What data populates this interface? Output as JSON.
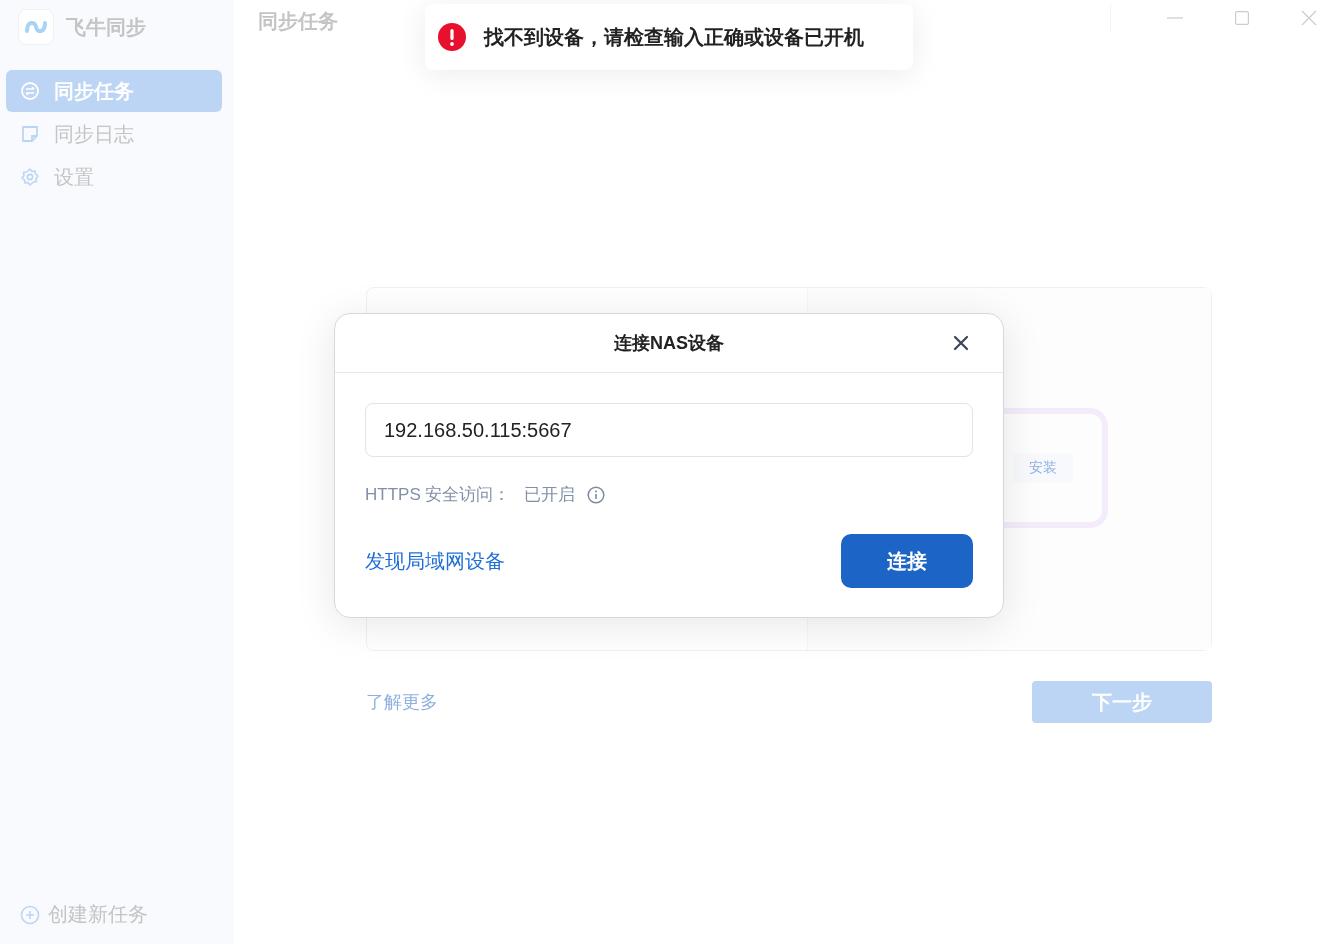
{
  "app": {
    "name": "飞牛同步"
  },
  "sidebar": {
    "items": [
      {
        "label": "同步任务",
        "kind": "sync",
        "selected": true
      },
      {
        "label": "同步日志",
        "kind": "note",
        "selected": false
      },
      {
        "label": "设置",
        "kind": "gear",
        "selected": false
      }
    ],
    "create_task": "创建新任务"
  },
  "header": {
    "title": "同步任务"
  },
  "background_card": {
    "install_button": "安装"
  },
  "learn_more": "了解更多",
  "next_button": "下一步",
  "toast": {
    "message": "找不到设备，请检查输入正确或设备已开机"
  },
  "dialog": {
    "title": "连接NAS设备",
    "address_value": "192.168.50.115:5667",
    "https_label": "HTTPS 安全访问：",
    "https_status": "已开启",
    "discover_link": "发现局域网设备",
    "connect_button": "连接"
  }
}
